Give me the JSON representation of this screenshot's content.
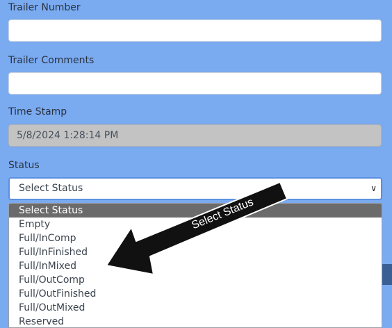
{
  "form": {
    "trailer_number": {
      "label": "Trailer Number",
      "value": ""
    },
    "trailer_comments": {
      "label": "Trailer Comments",
      "value": ""
    },
    "time_stamp": {
      "label": "Time Stamp",
      "value": "5/8/2024 1:28:14 PM"
    },
    "status": {
      "label": "Status",
      "selected": "Select Status",
      "options": [
        "Select Status",
        "Empty",
        "Full/InComp",
        "Full/InFinished",
        "Full/InMixed",
        "Full/OutComp",
        "Full/OutFinished",
        "Full/OutMixed",
        "Reserved"
      ]
    }
  },
  "annotation": {
    "text": "Select Status"
  },
  "colors": {
    "background": "#7aaaf0",
    "focus_border": "#5b8fe0",
    "highlight": "#6b6b6b",
    "disabled": "#c3c3c3"
  }
}
